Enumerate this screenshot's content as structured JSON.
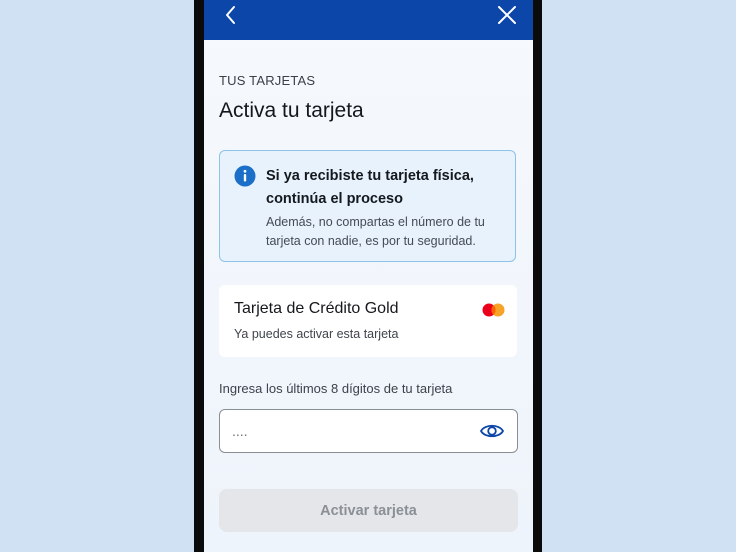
{
  "header": {
    "back_icon": "chevron-left-icon",
    "close_icon": "close-icon",
    "background_color": "#0c46a8"
  },
  "section_label": "TUS TARJETAS",
  "page_title": "Activa tu tarjeta",
  "info_box": {
    "icon": "info-icon",
    "title": "Si ya recibiste tu tarjeta física, continúa el proceso",
    "body": "Además, no compartas el número de tu tarjeta con nadie, es por tu seguridad."
  },
  "card": {
    "name": "Tarjeta de Crédito Gold",
    "status": "Ya puedes activar esta tarjeta",
    "brand_icon": "mastercard-icon"
  },
  "digits_field": {
    "label": "Ingresa los últimos 8 dígitos de tu tarjeta",
    "value": "....",
    "toggle_icon": "eye-icon"
  },
  "activate_button": {
    "label": "Activar tarjeta",
    "state": "disabled"
  }
}
